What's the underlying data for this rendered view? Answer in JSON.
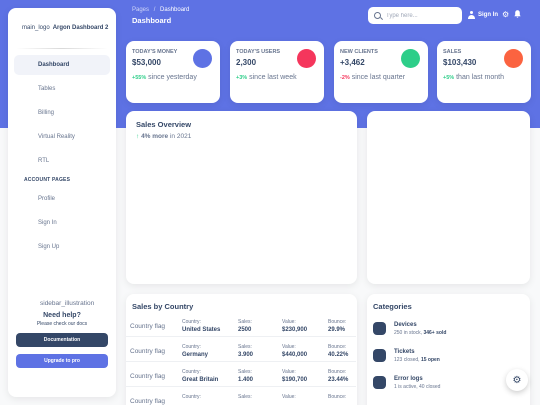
{
  "sidebar": {
    "logo_alt": "main_logo",
    "brand": "Argon Dashboard 2",
    "items": [
      {
        "label": "Dashboard"
      },
      {
        "label": "Tables"
      },
      {
        "label": "Billing"
      },
      {
        "label": "Virtual Reality"
      },
      {
        "label": "RTL"
      }
    ],
    "account_heading": "ACCOUNT PAGES",
    "account_items": [
      {
        "label": "Profile"
      },
      {
        "label": "Sign In"
      },
      {
        "label": "Sign Up"
      }
    ],
    "help": {
      "illustration_alt": "sidebar_illustration",
      "title": "Need help?",
      "subtitle": "Please check our docs",
      "doc_button": "Documentation",
      "upgrade_button": "Upgrade to pro"
    }
  },
  "header": {
    "breadcrumb_root": "Pages",
    "breadcrumb_sep": "/",
    "breadcrumb_current": "Dashboard",
    "title": "Dashboard",
    "search_placeholder": "Type here...",
    "signin": "Sign In",
    "icons": [
      "user-icon",
      "gear-icon",
      "bell-icon"
    ]
  },
  "stats": [
    {
      "label": "TODAY'S MONEY",
      "value": "$53,000",
      "change": "+55%",
      "change_text": " since yesterday",
      "change_color": "#2dce89",
      "icon_color": "#5e72e4"
    },
    {
      "label": "TODAY'S USERS",
      "value": "2,300",
      "change": "+3%",
      "change_text": " since last week",
      "change_color": "#2dce89",
      "icon_color": "#f5365c"
    },
    {
      "label": "NEW CLIENTS",
      "value": "+3,462",
      "change": "-2%",
      "change_text": " since last quarter",
      "change_color": "#f5365c",
      "icon_color": "#2dce89"
    },
    {
      "label": "SALES",
      "value": "$103,430",
      "change": "+5%",
      "change_text": " than last month",
      "change_color": "#2dce89",
      "icon_color": "#fb6340"
    }
  ],
  "overview": {
    "title": "Sales Overview",
    "arrow": "↑",
    "pct": "4% more",
    "suffix": " in 2021"
  },
  "countries": {
    "title": "Sales by Country",
    "flag_alt": "Country flag",
    "headers": {
      "country": "Country:",
      "sales": "Sales:",
      "value": "Value:",
      "bounce": "Bounce:"
    },
    "rows": [
      {
        "country": "United States",
        "sales": "2500",
        "value": "$230,900",
        "bounce": "29.9%"
      },
      {
        "country": "Germany",
        "sales": "3.900",
        "value": "$440,000",
        "bounce": "40.22%"
      },
      {
        "country": "Great Britain",
        "sales": "1.400",
        "value": "$190,700",
        "bounce": "23.44%"
      },
      {
        "country": "",
        "sales": "",
        "value": "",
        "bounce": ""
      }
    ]
  },
  "categories": {
    "title": "Categories",
    "items": [
      {
        "name": "Devices",
        "detail": "250 in stock, ",
        "detail_bold": "346+ sold"
      },
      {
        "name": "Tickets",
        "detail": "123 closed, ",
        "detail_bold": "15 open"
      },
      {
        "name": "Error logs",
        "detail": "1 is active, 40 closed",
        "detail_bold": ""
      }
    ]
  },
  "fab_icon": "gear-icon"
}
